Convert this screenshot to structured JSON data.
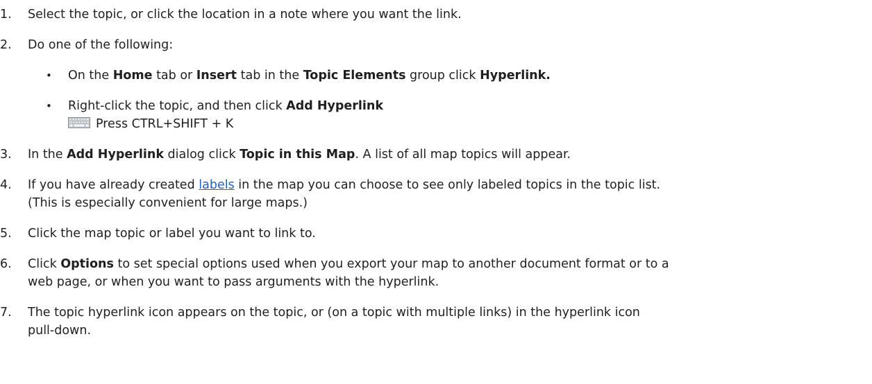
{
  "steps": [
    {
      "number": "1.",
      "text": "Select the topic, or click the location in a note where you want the link."
    },
    {
      "number": "2.",
      "text": "Do one of the following:"
    },
    {
      "number": "3.",
      "pre": "In the ",
      "b1": "Add Hyperlink",
      "mid": " dialog click ",
      "b2": "Topic in this Map",
      "post": ". A list of all map topics will appear."
    },
    {
      "number": "4.",
      "pre": "If you have already created ",
      "link": "labels",
      "post": " in the map you can choose to see only labeled topics in the topic list.",
      "line2": "(This is especially convenient for large maps.)"
    },
    {
      "number": "5.",
      "text": "Click the map topic or label you want to link to."
    },
    {
      "number": "6.",
      "pre": "Click ",
      "b1": "Options",
      "post": " to set special options used when you export your map to another document format or to a",
      "line2": "web page, or when you want to pass arguments with the hyperlink."
    },
    {
      "number": "7.",
      "text": "The topic hyperlink icon appears on the topic, or (on a topic with multiple links) in the hyperlink icon",
      "line2": "pull-down."
    }
  ],
  "bullets": [
    {
      "bullet": "•",
      "pre": "On the ",
      "b1": "Home",
      "mid1": " tab or ",
      "b2": "Insert",
      "mid2": " tab in the ",
      "b3": "Topic Elements",
      "mid3": " group click ",
      "b4": "Hyperlink."
    },
    {
      "bullet": "•",
      "pre": "Right-click the topic, and then click ",
      "b1": "Add Hyperlink"
    }
  ],
  "shortcut": {
    "icon": "keyboard-icon",
    "text": "Press CTRL+SHIFT + K"
  }
}
